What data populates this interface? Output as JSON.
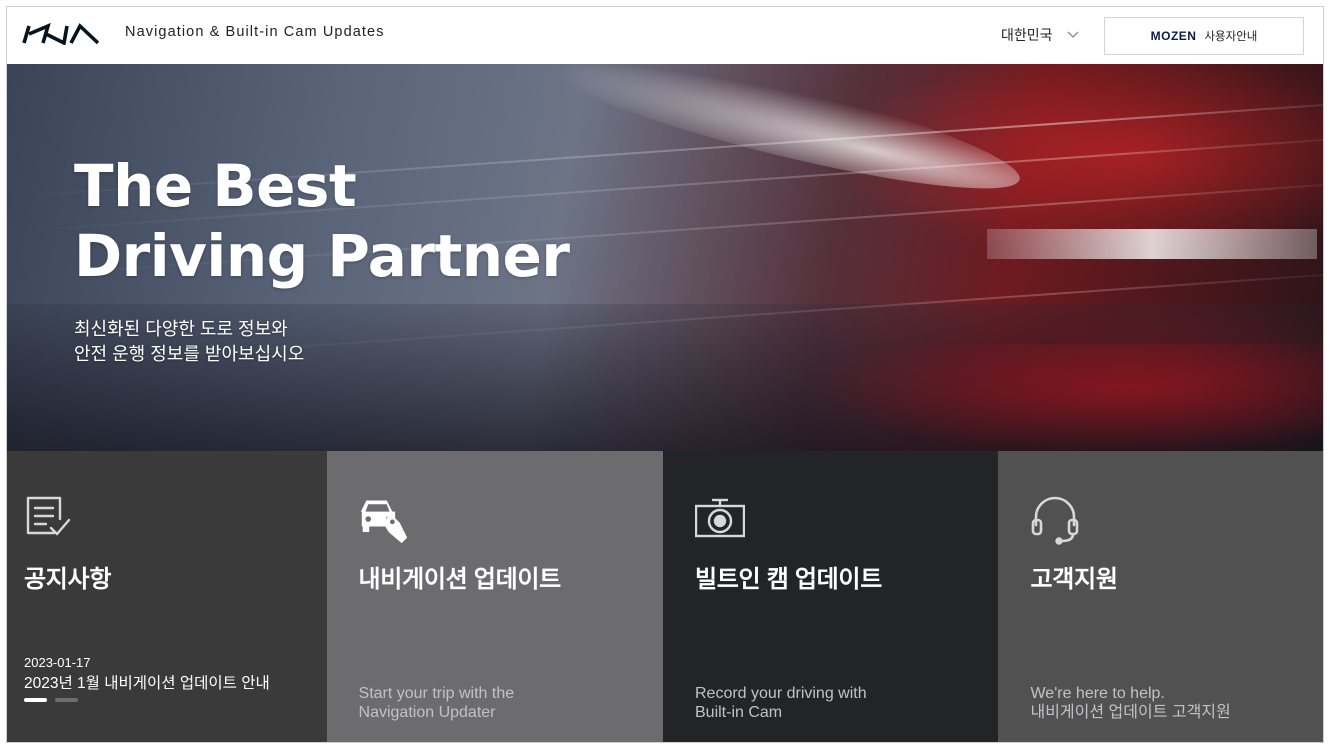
{
  "header": {
    "brand": "KIA",
    "site_title": "Navigation & Built-in Cam Updates",
    "country": "대한민국",
    "mozen_logo": "MOZEN",
    "mozen_label": "사용자안내"
  },
  "hero": {
    "title_line1": "The Best",
    "title_line2": "Driving Partner",
    "sub_line1": "최신화된 다양한 도로 정보와",
    "sub_line2": "안전 운행 정보를 받아보십시오"
  },
  "tiles": {
    "notice": {
      "title": "공지사항",
      "date": "2023-01-17",
      "text": "2023년 1월 내비게이션 업데이트 안내",
      "slides": 2,
      "active_slide": 1
    },
    "navigation": {
      "title": "내비게이션 업데이트",
      "desc_line1": "Start your trip with the",
      "desc_line2": "Navigation Updater"
    },
    "cam": {
      "title": "빌트인 캠 업데이트",
      "desc_line1": "Record your driving with",
      "desc_line2": "Built-in Cam"
    },
    "support": {
      "title": "고객지원",
      "desc_line1": "We're here to help.",
      "desc_line2": "내비게이션 업데이트 고객지원"
    }
  },
  "colors": {
    "tile_notice": "#3a3a3b",
    "tile_navigation": "#6c6c6e",
    "tile_cam": "#232427",
    "tile_support": "#515152",
    "mozen_brand": "#0b1d4f"
  },
  "icons": [
    "kia-logo",
    "chevron-down-icon",
    "notice-document-icon",
    "car-tag-icon",
    "camera-icon",
    "headset-icon"
  ]
}
